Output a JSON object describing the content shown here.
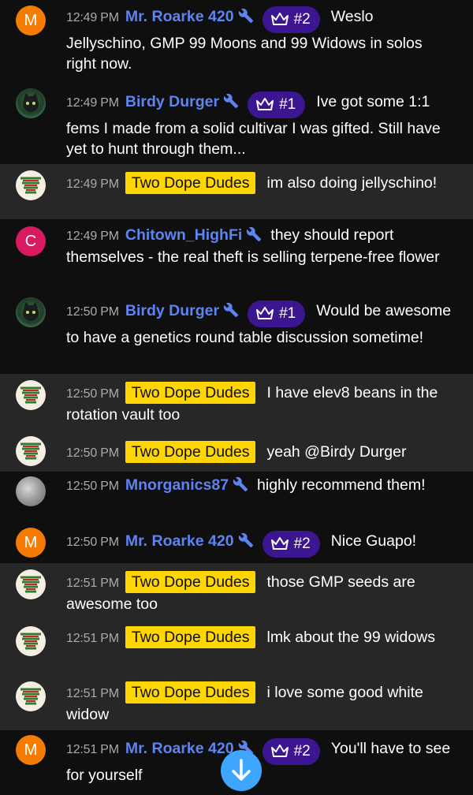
{
  "messages": [
    {
      "avatar": "M",
      "time": "12:49 PM",
      "author": "Mr. Roarke 420",
      "rank": "#2",
      "text": "Weslo Jellyschino, GMP 99 Moons and 99 Widows in solos right now."
    },
    {
      "avatar": "cat-avatar",
      "time": "12:49 PM",
      "author": "Birdy Durger",
      "rank": "#1",
      "text": "Ive got some 1:1 fems I made from a solid cultivar I was gifted. Still have yet to hunt through them..."
    },
    {
      "avatar": "dope-avatar",
      "time": "12:49 PM",
      "author": "Two Dope Dudes",
      "text": "im also doing jellyschino!"
    },
    {
      "avatar": "C",
      "time": "12:49 PM",
      "author": "Chitown_HighFi",
      "text": "they should report themselves - the real theft is selling terpene-free flower"
    },
    {
      "avatar": "cat-avatar",
      "time": "12:50 PM",
      "author": "Birdy Durger",
      "rank": "#1",
      "text": "Would be awesome to have a genetics round table discussion sometime!"
    },
    {
      "avatar": "dope-avatar",
      "time": "12:50 PM",
      "author": "Two Dope Dudes",
      "text": "I have elev8 beans in the rotation vault too"
    },
    {
      "avatar": "dope-avatar",
      "time": "12:50 PM",
      "author": "Two Dope Dudes",
      "text": "yeah @Birdy Durger"
    },
    {
      "avatar": "photo-avatar",
      "time": "12:50 PM",
      "author": "Mnorganics87",
      "text": "highly recommend them!"
    },
    {
      "avatar": "M",
      "time": "12:50 PM",
      "author": "Mr. Roarke 420",
      "rank": "#2",
      "text": "Nice Guapo!"
    },
    {
      "avatar": "dope-avatar",
      "time": "12:51 PM",
      "author": "Two Dope Dudes",
      "text": "those GMP seeds are awesome too"
    },
    {
      "avatar": "dope-avatar",
      "time": "12:51 PM",
      "author": "Two Dope Dudes",
      "text": "lmk about the 99 widows"
    },
    {
      "avatar": "dope-avatar",
      "time": "12:51 PM",
      "author": "Two Dope Dudes",
      "text": "i love some good white widow"
    },
    {
      "avatar": "M",
      "time": "12:51 PM",
      "author": "Mr. Roarke 420",
      "rank": "#2",
      "text": "You'll have to see for yourself"
    }
  ],
  "scroll_button": {
    "icon": "arrow-down-icon"
  },
  "colors": {
    "background": "#0f0f0f",
    "highlight_row": "#272727",
    "author_link": "#5e84f1",
    "owner_badge": "#ffd600",
    "rank_badge": "#3c1590",
    "scroll_button": "#3ea6ff"
  }
}
